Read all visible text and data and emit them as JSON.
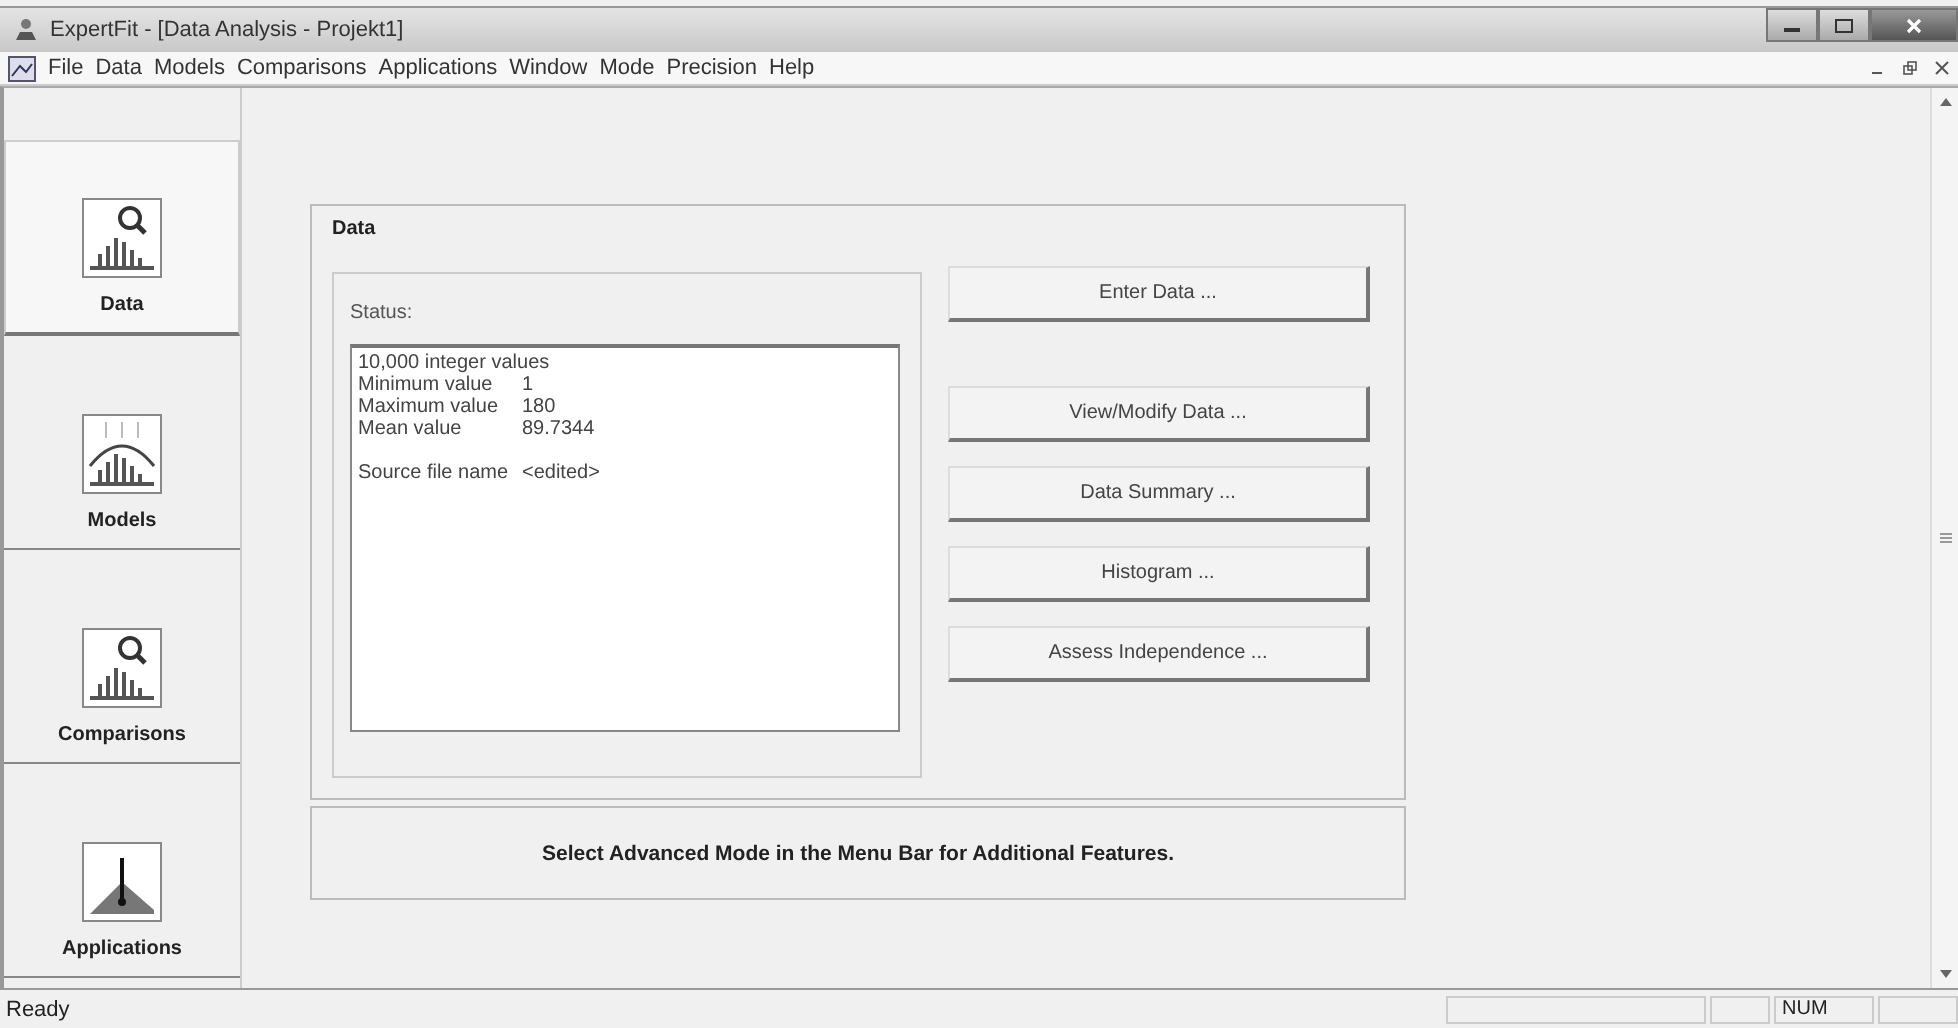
{
  "window": {
    "title": "ExpertFit - [Data Analysis - Projekt1]"
  },
  "menu": [
    "File",
    "Data",
    "Models",
    "Comparisons",
    "Applications",
    "Window",
    "Mode",
    "Precision",
    "Help"
  ],
  "sidebar": [
    {
      "label": "Data",
      "kind": "search",
      "selected": true
    },
    {
      "label": "Models",
      "kind": "curve",
      "selected": false
    },
    {
      "label": "Comparisons",
      "kind": "search",
      "selected": false
    },
    {
      "label": "Applications",
      "kind": "peak",
      "selected": false
    }
  ],
  "panel": {
    "title": "Data",
    "status_label": "Status:",
    "status_groups": [
      [
        {
          "label": "10,000 integer values"
        },
        {
          "label": "Minimum value",
          "value": "1"
        },
        {
          "label": "Maximum value",
          "value": "180"
        },
        {
          "label": "Mean value",
          "value": "89.7344"
        }
      ],
      [
        {
          "label": "Source file name",
          "value": "<edited>"
        }
      ]
    ],
    "button_groups": [
      [
        "Enter Data ..."
      ],
      [
        "View/Modify Data ...",
        "Data Summary ...",
        "Histogram ...",
        "Assess Independence ..."
      ]
    ]
  },
  "hint": "Select Advanced Mode in the Menu Bar for Additional Features.",
  "status_bar": {
    "text": "Ready",
    "num": "NUM"
  }
}
